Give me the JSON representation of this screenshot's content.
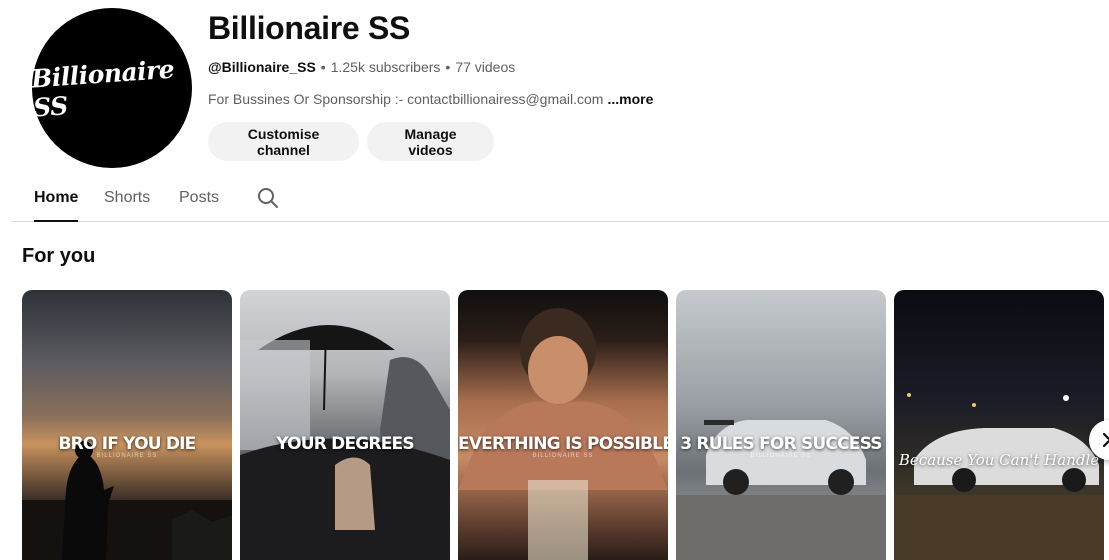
{
  "channel": {
    "avatar_text": "Billionaire SS",
    "name": "Billionaire SS",
    "handle": "@Billionaire_SS",
    "subscribers": "1.25k subscribers",
    "videos": "77 videos",
    "description": "For Bussines Or Sponsorship :- contactbillionairess@gmail.com",
    "more_label": "...more"
  },
  "actions": {
    "customise_label": "Customise channel",
    "manage_label": "Manage videos"
  },
  "tabs": [
    {
      "label": "Home",
      "active": true
    },
    {
      "label": "Shorts",
      "active": false
    },
    {
      "label": "Posts",
      "active": false
    }
  ],
  "section": {
    "title": "For you"
  },
  "shorts": [
    {
      "title": "BRO IF YOU DIE",
      "watermark": "BILLIONAIRE SS"
    },
    {
      "title": "YOUR DEGREES",
      "watermark": ""
    },
    {
      "title": "EVERTHING IS POSSIBLE",
      "watermark": "BILLIONAIRE SS"
    },
    {
      "title": "3 RULES FOR SUCCESS",
      "watermark": "BILLIONAIRE SS"
    },
    {
      "title": "Because You Can't Handle",
      "watermark": ""
    }
  ],
  "icons": {
    "search": "search-icon",
    "next": "chevron-right-icon"
  }
}
